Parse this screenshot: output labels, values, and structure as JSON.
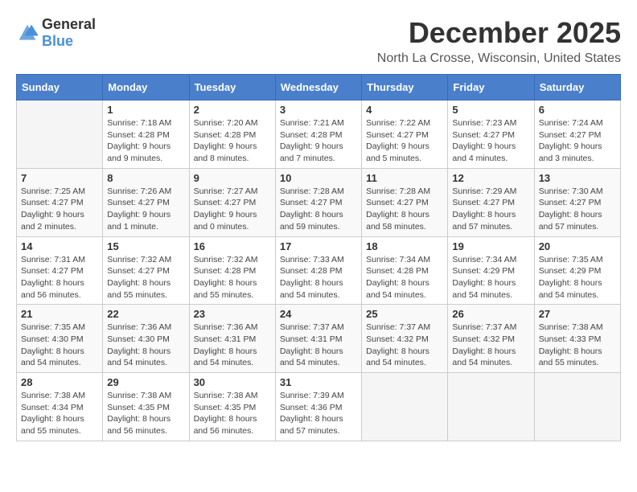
{
  "logo": {
    "general": "General",
    "blue": "Blue"
  },
  "title": "December 2025",
  "subtitle": "North La Crosse, Wisconsin, United States",
  "days_of_week": [
    "Sunday",
    "Monday",
    "Tuesday",
    "Wednesday",
    "Thursday",
    "Friday",
    "Saturday"
  ],
  "weeks": [
    [
      {
        "day": "",
        "info": ""
      },
      {
        "day": "1",
        "info": "Sunrise: 7:18 AM\nSunset: 4:28 PM\nDaylight: 9 hours\nand 9 minutes."
      },
      {
        "day": "2",
        "info": "Sunrise: 7:20 AM\nSunset: 4:28 PM\nDaylight: 9 hours\nand 8 minutes."
      },
      {
        "day": "3",
        "info": "Sunrise: 7:21 AM\nSunset: 4:28 PM\nDaylight: 9 hours\nand 7 minutes."
      },
      {
        "day": "4",
        "info": "Sunrise: 7:22 AM\nSunset: 4:27 PM\nDaylight: 9 hours\nand 5 minutes."
      },
      {
        "day": "5",
        "info": "Sunrise: 7:23 AM\nSunset: 4:27 PM\nDaylight: 9 hours\nand 4 minutes."
      },
      {
        "day": "6",
        "info": "Sunrise: 7:24 AM\nSunset: 4:27 PM\nDaylight: 9 hours\nand 3 minutes."
      }
    ],
    [
      {
        "day": "7",
        "info": "Sunrise: 7:25 AM\nSunset: 4:27 PM\nDaylight: 9 hours\nand 2 minutes."
      },
      {
        "day": "8",
        "info": "Sunrise: 7:26 AM\nSunset: 4:27 PM\nDaylight: 9 hours\nand 1 minute."
      },
      {
        "day": "9",
        "info": "Sunrise: 7:27 AM\nSunset: 4:27 PM\nDaylight: 9 hours\nand 0 minutes."
      },
      {
        "day": "10",
        "info": "Sunrise: 7:28 AM\nSunset: 4:27 PM\nDaylight: 8 hours\nand 59 minutes."
      },
      {
        "day": "11",
        "info": "Sunrise: 7:28 AM\nSunset: 4:27 PM\nDaylight: 8 hours\nand 58 minutes."
      },
      {
        "day": "12",
        "info": "Sunrise: 7:29 AM\nSunset: 4:27 PM\nDaylight: 8 hours\nand 57 minutes."
      },
      {
        "day": "13",
        "info": "Sunrise: 7:30 AM\nSunset: 4:27 PM\nDaylight: 8 hours\nand 57 minutes."
      }
    ],
    [
      {
        "day": "14",
        "info": "Sunrise: 7:31 AM\nSunset: 4:27 PM\nDaylight: 8 hours\nand 56 minutes."
      },
      {
        "day": "15",
        "info": "Sunrise: 7:32 AM\nSunset: 4:27 PM\nDaylight: 8 hours\nand 55 minutes."
      },
      {
        "day": "16",
        "info": "Sunrise: 7:32 AM\nSunset: 4:28 PM\nDaylight: 8 hours\nand 55 minutes."
      },
      {
        "day": "17",
        "info": "Sunrise: 7:33 AM\nSunset: 4:28 PM\nDaylight: 8 hours\nand 54 minutes."
      },
      {
        "day": "18",
        "info": "Sunrise: 7:34 AM\nSunset: 4:28 PM\nDaylight: 8 hours\nand 54 minutes."
      },
      {
        "day": "19",
        "info": "Sunrise: 7:34 AM\nSunset: 4:29 PM\nDaylight: 8 hours\nand 54 minutes."
      },
      {
        "day": "20",
        "info": "Sunrise: 7:35 AM\nSunset: 4:29 PM\nDaylight: 8 hours\nand 54 minutes."
      }
    ],
    [
      {
        "day": "21",
        "info": "Sunrise: 7:35 AM\nSunset: 4:30 PM\nDaylight: 8 hours\nand 54 minutes."
      },
      {
        "day": "22",
        "info": "Sunrise: 7:36 AM\nSunset: 4:30 PM\nDaylight: 8 hours\nand 54 minutes."
      },
      {
        "day": "23",
        "info": "Sunrise: 7:36 AM\nSunset: 4:31 PM\nDaylight: 8 hours\nand 54 minutes."
      },
      {
        "day": "24",
        "info": "Sunrise: 7:37 AM\nSunset: 4:31 PM\nDaylight: 8 hours\nand 54 minutes."
      },
      {
        "day": "25",
        "info": "Sunrise: 7:37 AM\nSunset: 4:32 PM\nDaylight: 8 hours\nand 54 minutes."
      },
      {
        "day": "26",
        "info": "Sunrise: 7:37 AM\nSunset: 4:32 PM\nDaylight: 8 hours\nand 54 minutes."
      },
      {
        "day": "27",
        "info": "Sunrise: 7:38 AM\nSunset: 4:33 PM\nDaylight: 8 hours\nand 55 minutes."
      }
    ],
    [
      {
        "day": "28",
        "info": "Sunrise: 7:38 AM\nSunset: 4:34 PM\nDaylight: 8 hours\nand 55 minutes."
      },
      {
        "day": "29",
        "info": "Sunrise: 7:38 AM\nSunset: 4:35 PM\nDaylight: 8 hours\nand 56 minutes."
      },
      {
        "day": "30",
        "info": "Sunrise: 7:38 AM\nSunset: 4:35 PM\nDaylight: 8 hours\nand 56 minutes."
      },
      {
        "day": "31",
        "info": "Sunrise: 7:39 AM\nSunset: 4:36 PM\nDaylight: 8 hours\nand 57 minutes."
      },
      {
        "day": "",
        "info": ""
      },
      {
        "day": "",
        "info": ""
      },
      {
        "day": "",
        "info": ""
      }
    ]
  ]
}
